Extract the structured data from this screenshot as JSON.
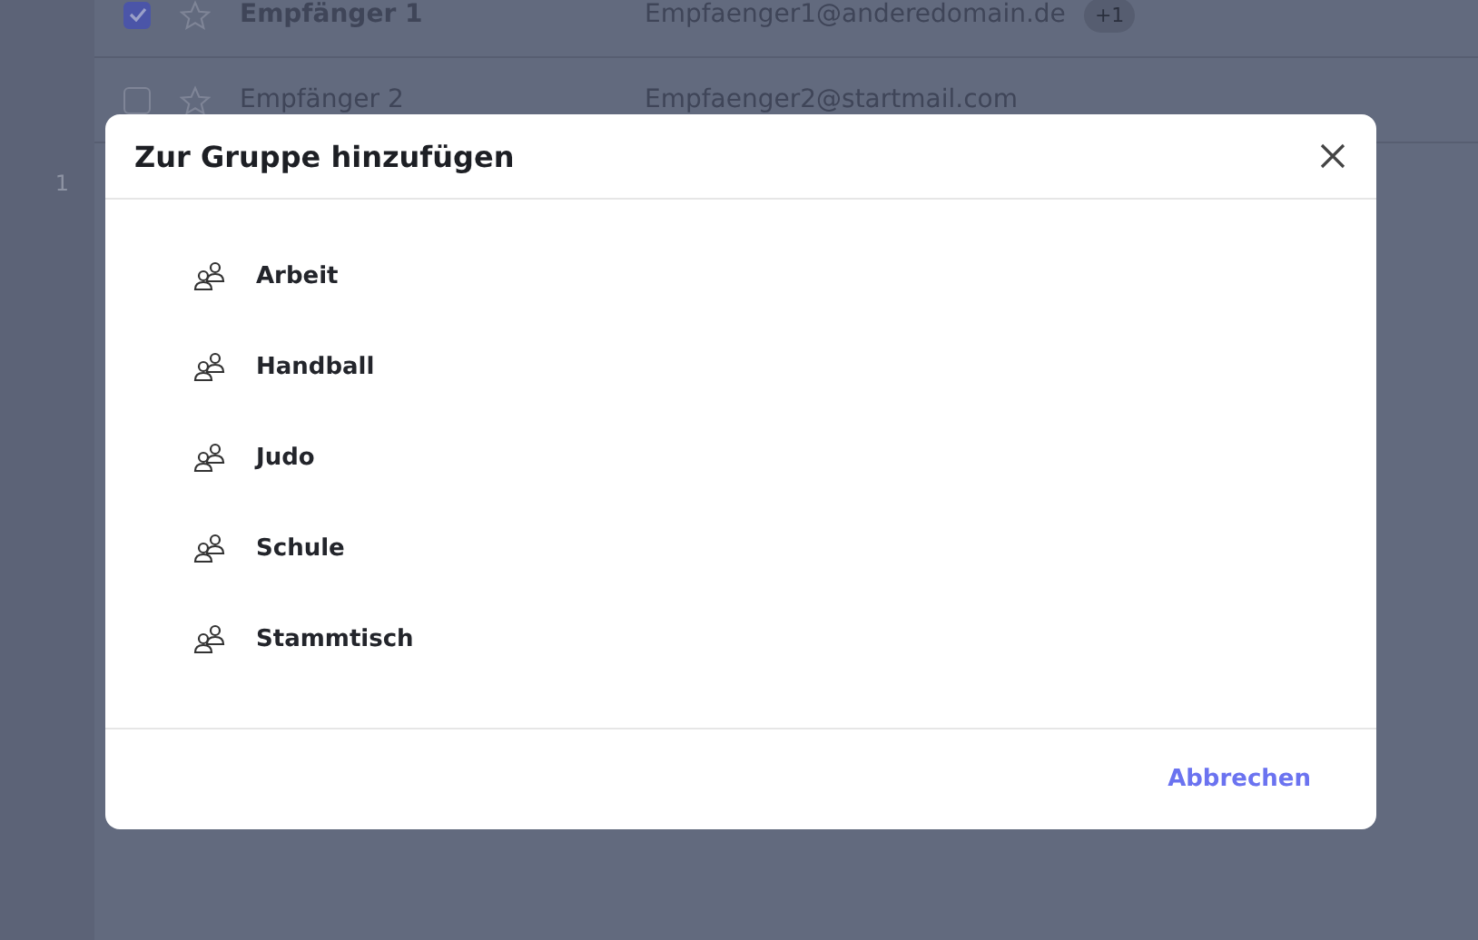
{
  "sidebar": {
    "count": "1"
  },
  "contacts": [
    {
      "name": "Empfänger 1",
      "email": "Empfaenger1@anderedomain.de",
      "extra": "+1",
      "checked": true,
      "starred": false,
      "unread": true
    },
    {
      "name": "Empfänger 2",
      "email": "Empfaenger2@startmail.com",
      "checked": false,
      "starred": false,
      "unread": false
    }
  ],
  "dialog": {
    "title": "Zur Gruppe hinzufügen",
    "groups": [
      {
        "label": "Arbeit"
      },
      {
        "label": "Handball"
      },
      {
        "label": "Judo"
      },
      {
        "label": "Schule"
      },
      {
        "label": "Stammtisch"
      }
    ],
    "cancel": "Abbrechen"
  }
}
